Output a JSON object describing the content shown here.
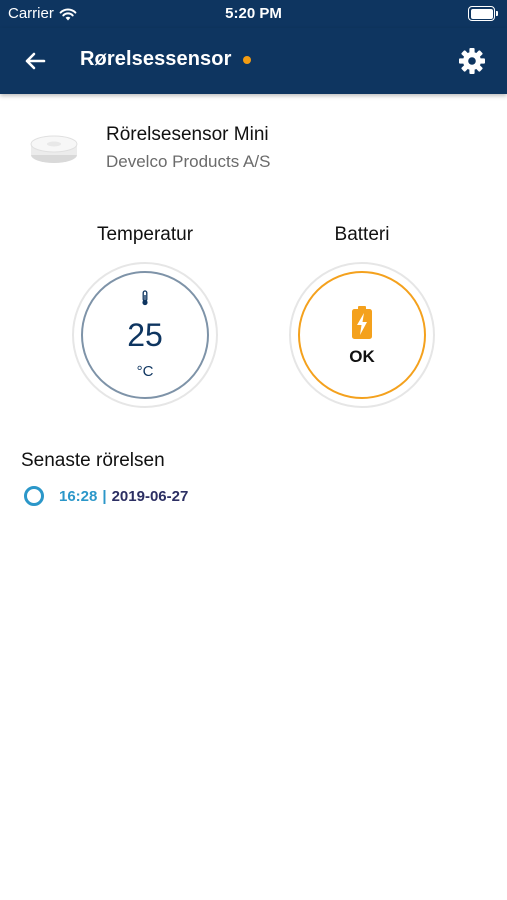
{
  "status_bar": {
    "carrier": "Carrier",
    "time": "5:20 PM"
  },
  "header": {
    "title": "Rørelsessensor",
    "back_icon": "arrow-left-icon",
    "settings_icon": "gear-icon",
    "indicator_color": "#f39c12"
  },
  "device": {
    "name": "Rörelsesensor Mini",
    "vendor": "Develco Products A/S"
  },
  "temperature": {
    "label": "Temperatur",
    "value": "25",
    "unit": "°C",
    "icon": "thermometer-icon"
  },
  "battery": {
    "label": "Batteri",
    "status": "OK",
    "icon": "battery-charging-icon",
    "color": "#f4a11d"
  },
  "last_motion": {
    "title": "Senaste rörelsen",
    "time": "16:28",
    "separator": "|",
    "date": "2019-06-27"
  },
  "colors": {
    "brand": "#0e3560",
    "accent": "#2b97c9"
  }
}
